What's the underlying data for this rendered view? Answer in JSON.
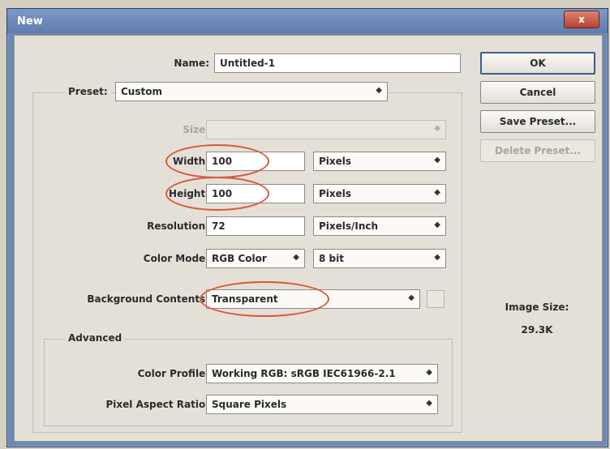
{
  "window": {
    "title": "New",
    "close_label": "x"
  },
  "fields": {
    "name": {
      "label": "Name:",
      "value": "Untitled-1"
    },
    "preset": {
      "label": "Preset:",
      "value": "Custom"
    },
    "size": {
      "label": "Size:",
      "value": ""
    },
    "width": {
      "label": "Width:",
      "value": "100",
      "unit": "Pixels"
    },
    "height": {
      "label": "Height:",
      "value": "100",
      "unit": "Pixels"
    },
    "resolution": {
      "label": "Resolution:",
      "value": "72",
      "unit": "Pixels/Inch"
    },
    "color_mode": {
      "label": "Color Mode:",
      "value": "RGB Color",
      "depth": "8 bit"
    },
    "background": {
      "label": "Background Contents:",
      "value": "Transparent"
    }
  },
  "advanced": {
    "title": "Advanced",
    "color_profile": {
      "label": "Color Profile:",
      "value": "Working RGB:  sRGB IEC61966-2.1"
    },
    "pixel_aspect": {
      "label": "Pixel Aspect Ratio:",
      "value": "Square Pixels"
    }
  },
  "buttons": {
    "ok": "OK",
    "cancel": "Cancel",
    "save_preset": "Save Preset...",
    "delete_preset": "Delete Preset..."
  },
  "image_size": {
    "label": "Image Size:",
    "value": "29.3K"
  },
  "colors": {
    "highlight_ring": "#d9573a",
    "title_bar": "#6b88b6"
  }
}
